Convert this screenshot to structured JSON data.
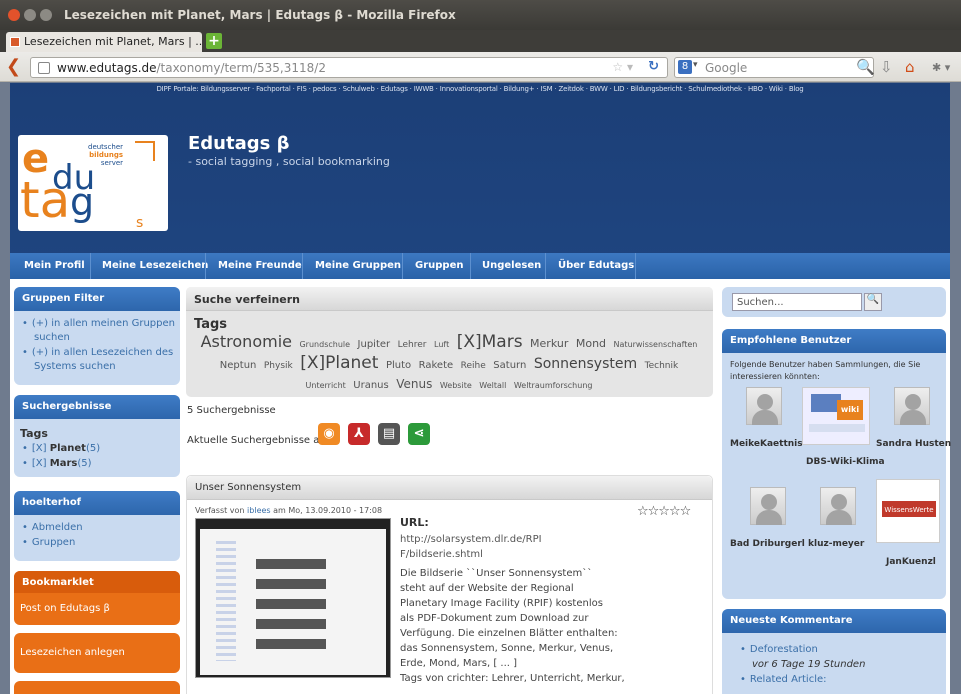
{
  "window": {
    "title": "Lesezeichen mit Planet, Mars | Edutags β - Mozilla Firefox"
  },
  "tabs": [
    {
      "label": "Lesezeichen mit Planet, Mars | ..."
    }
  ],
  "newtab_symbol": "+",
  "addressbar": {
    "domain": "www.edutags.de",
    "path": "/taxonomy/term/535,3118/2"
  },
  "searchbar": {
    "placeholder": "Google",
    "engine_icon": "google-icon"
  },
  "site": {
    "portals": "DIPF Portale: Bildungsserver · Fachportal · FIS · pedocs · Schulweb · Edutags · IWWB · Innovationsportal · Bildung+ · ISM · Zeitdok · BWW · LID · Bildungsbericht · Schulmediothek · HBO · Wiki · Blog",
    "name": "Edutags β",
    "slogan": "- social tagging , social bookmarking",
    "logo": {
      "e": "e",
      "du": "du",
      "ta": "ta",
      "g": "g",
      "s": "s",
      "line1": "deutscher",
      "line2": "bildungs",
      "line3": "server"
    }
  },
  "menu": [
    "Mein Profil",
    "Meine Lesezeichen",
    "Meine Freunde",
    "Meine Gruppen",
    "Gruppen",
    "Ungelesen",
    "Über Edutags"
  ],
  "left": {
    "gruppen_filter": {
      "title": "Gruppen Filter",
      "items": [
        "(+) in allen meinen Gruppen suchen",
        "(+) in allen Lesezeichen des Systems suchen"
      ]
    },
    "suchergebnisse": {
      "title": "Suchergebnisse",
      "tags_label": "Tags",
      "items": [
        {
          "prefix": "[X]",
          "label": "Planet",
          "count": "(5)"
        },
        {
          "prefix": "[X]",
          "label": "Mars",
          "count": "(5)"
        }
      ]
    },
    "user": {
      "title": "hoelterhof",
      "items": [
        "Abmelden",
        "Gruppen"
      ]
    },
    "bookmarklet": {
      "title": "Bookmarklet",
      "link": "Post on Edutags β"
    },
    "anlegen": "Lesezeichen anlegen"
  },
  "center": {
    "refine": {
      "title": "Suche verfeinern",
      "tags_label": "Tags"
    },
    "tagcloud": [
      {
        "t": "Astronomie",
        "s": 16
      },
      {
        "t": "Grundschule",
        "s": 8
      },
      {
        "t": "Jupiter",
        "s": 10
      },
      {
        "t": "Lehrer",
        "s": 9
      },
      {
        "t": "Luft",
        "s": 8
      },
      {
        "t": "[X]Mars",
        "s": 17
      },
      {
        "t": "Merkur",
        "s": 11
      },
      {
        "t": "Mond",
        "s": 11
      },
      {
        "t": "Naturwissenschaften",
        "s": 8
      },
      {
        "t": "Neptun",
        "s": 10
      },
      {
        "t": "Physik",
        "s": 9
      },
      {
        "t": "[X]Planet",
        "s": 17
      },
      {
        "t": "Pluto",
        "s": 10
      },
      {
        "t": "Rakete",
        "s": 10
      },
      {
        "t": "Reihe",
        "s": 9
      },
      {
        "t": "Saturn",
        "s": 10
      },
      {
        "t": "Sonnensystem",
        "s": 14
      },
      {
        "t": "Technik",
        "s": 9
      },
      {
        "t": "Unterricht",
        "s": 8
      },
      {
        "t": "Uranus",
        "s": 10
      },
      {
        "t": "Venus",
        "s": 12
      },
      {
        "t": "Website",
        "s": 8
      },
      {
        "t": "Weltall",
        "s": 8
      },
      {
        "t": "Weltraumforschung",
        "s": 8
      }
    ],
    "result_count": "5 Suchergebnisse",
    "export_label": "Aktuelle Suchergebnisse als",
    "export_icons": [
      "rss-icon",
      "pdf-icon",
      "print-icon",
      "share-icon"
    ],
    "entry": {
      "title": "Unser Sonnensystem",
      "meta_prefix": "Verfasst von",
      "author": "iblees",
      "meta_date": "am Mo, 13.09.2010 - 17:08",
      "rating": "☆☆☆☆☆",
      "url_label": "URL:",
      "url": "http://solarsystem.dlr.de/RPIF/bildserie.shtml",
      "description": "Die Bildserie ``Unser Sonnensystem`` steht auf der Website der Regional Planetary Image Facility (RPIF) kostenlos als PDF-Dokument zum Download zur Verfügung. Die einzelnen Blätter enthalten: das Sonnensystem, Sonne, Merkur, Venus, Erde, Mond, Mars, [ ... ]",
      "tags_line": "Tags von crichter: Lehrer, Unterricht, Merkur,"
    }
  },
  "right": {
    "search": {
      "placeholder": "Suchen..."
    },
    "empfohlen": {
      "title": "Empfohlene Benutzer",
      "intro": "Folgende Benutzer haben Sammlungen, die Sie interessieren könnten:",
      "users": [
        "MeikeKaettnis",
        "DBS-Wiki-Klima",
        "Sandra Husten",
        "Bad Driburgerl",
        "kluz-meyer",
        "JanKuenzl"
      ],
      "dbs_wiki_badge": "wiki",
      "jan_badge": "WissensWerte"
    },
    "kommentare": {
      "title": "Neueste Kommentare",
      "items": [
        {
          "title": "Deforestation",
          "meta": "vor 6 Tage 19 Stunden"
        },
        {
          "title": "Related Article:",
          "meta": ""
        }
      ]
    }
  }
}
